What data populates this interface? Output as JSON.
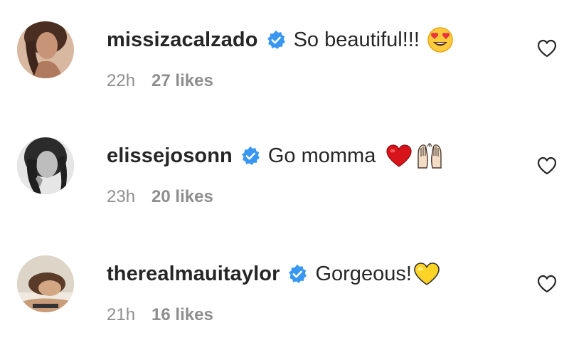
{
  "comments": [
    {
      "username": "missizacalzado",
      "text": "So beautiful!!!",
      "emoji": "heart-eyes-emoji",
      "time": "22h",
      "likes": "27 likes"
    },
    {
      "username": "elissejosonn",
      "text": "Go momma",
      "emoji": "red-heart-and-raised-hands-emoji",
      "time": "23h",
      "likes": "20 likes"
    },
    {
      "username": "therealmauitaylor",
      "text": "Gorgeous!",
      "emoji": "yellow-heart-emoji",
      "time": "21h",
      "likes": "16 likes"
    }
  ],
  "colors": {
    "text": "#262626",
    "muted": "#8e8e8e",
    "verified": "#3897f0"
  }
}
